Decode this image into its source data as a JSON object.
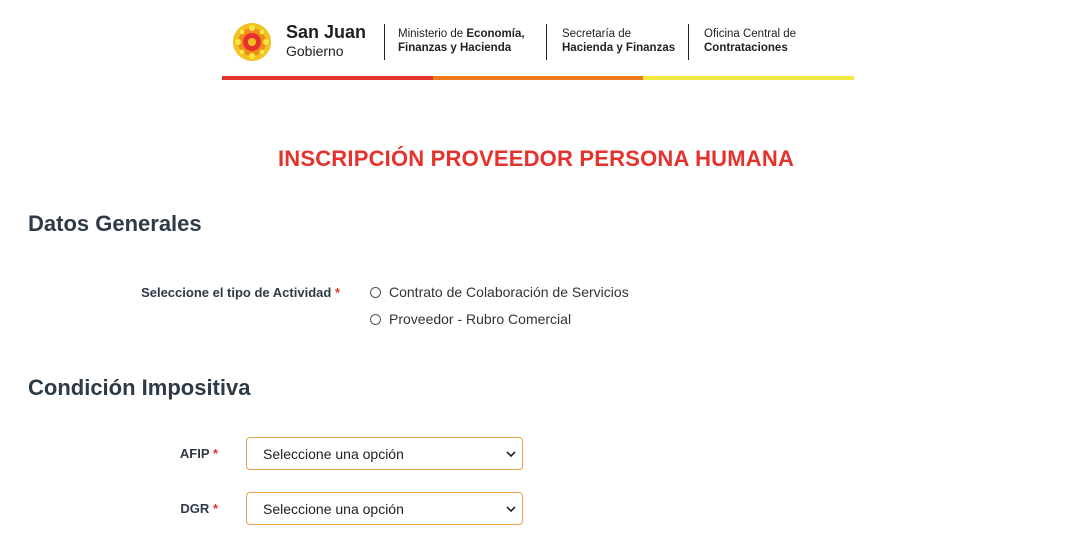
{
  "header": {
    "brand_title": "San Juan",
    "brand_sub": "Gobierno",
    "ministerio_line1_prefix": "Ministerio de ",
    "ministerio_line1_bold": "Economía,",
    "ministerio_line2": "Finanzas y Hacienda",
    "secretaria_line1": "Secretaría  de",
    "secretaria_line2": "Hacienda y Finanzas",
    "oficina_line1": "Oficina Central de",
    "oficina_line2": "Contrataciones",
    "colorbar": [
      "#e5322d",
      "#f07a1a",
      "#f4e842"
    ]
  },
  "page_title": "INSCRIPCIÓN PROVEEDOR PERSONA HUMANA",
  "datos_generales": {
    "title": "Datos Generales",
    "actividad_label": "Seleccione el tipo de Actividad",
    "required_mark": "*",
    "options": [
      "Contrato de Colaboración de Servicios",
      "Proveedor - Rubro Comercial"
    ]
  },
  "condicion_impositiva": {
    "title": "Condición Impositiva",
    "afip_label": "AFIP",
    "dgr_label": "DGR",
    "required_mark": "*",
    "afip_value": "Seleccione una opción",
    "dgr_value": "Seleccione una opción"
  },
  "colors": {
    "accent_red": "#e5322d",
    "select_border": "#e8a24a"
  }
}
